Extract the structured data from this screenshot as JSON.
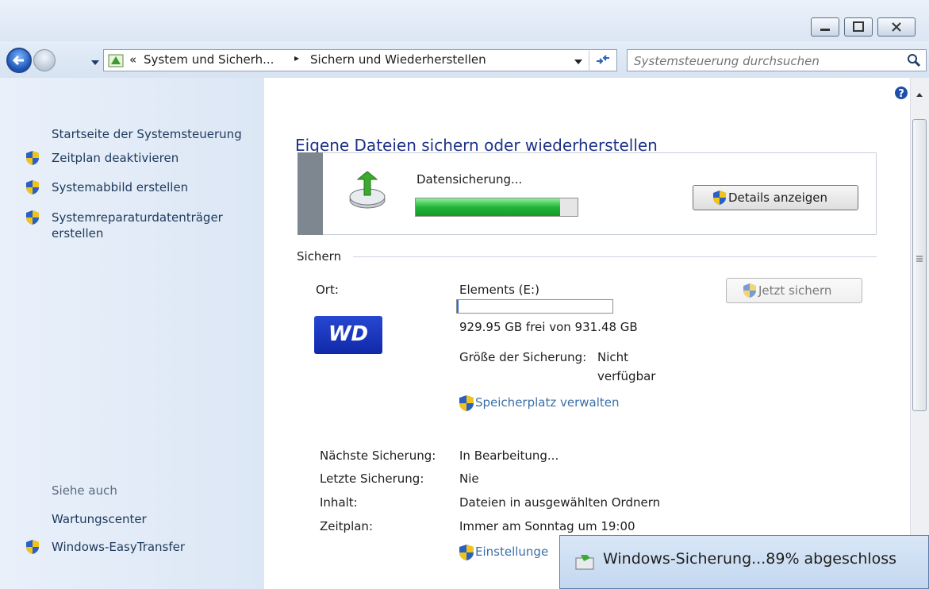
{
  "address_bar": {
    "crumb_overflow": "«",
    "crumb_1": "System und Sicherh...",
    "crumb_sep": "▸",
    "crumb_2": "Sichern und Wiederherstellen"
  },
  "search": {
    "placeholder": "Systemsteuerung durchsuchen"
  },
  "sidebar": {
    "home": "Startseite der Systemsteuerung",
    "tasks": [
      "Zeitplan deaktivieren",
      "Systemabbild erstellen",
      "Systemreparaturdatenträger",
      "erstellen"
    ],
    "see_also_header": "Siehe auch",
    "see_also": [
      "Wartungscenter",
      "Windows-EasyTransfer"
    ]
  },
  "main": {
    "title": "Eigene Dateien sichern oder wiederherstellen",
    "status_text": "Datensicherung...",
    "progress": 0.89,
    "details_button": "Details anzeigen",
    "section_label": "Sichern",
    "location_label": "Ort:",
    "location_value": "Elements (E:)",
    "drive_used_fraction": 0.002,
    "free_space": "929.95 GB frei von 931.48 GB",
    "backup_size_label": "Größe der Sicherung:",
    "backup_size_value_1": "Nicht",
    "backup_size_value_2": "verfügbar",
    "manage_space_link": "Speicherplatz verwalten",
    "backup_now_button": "Jetzt sichern",
    "drive_logo_text": "WD",
    "next_backup_label": "Nächste Sicherung:",
    "next_backup_value": "In Bearbeitung...",
    "last_backup_label": "Letzte Sicherung:",
    "last_backup_value": "Nie",
    "content_label": "Inhalt:",
    "content_value": "Dateien in ausgewählten Ordnern",
    "schedule_label": "Zeitplan:",
    "schedule_value": "Immer am Sonntag um 19:00",
    "settings_link": "Einstellunge"
  },
  "popup": {
    "title": "Windows-Sicherung...89% abgeschloss"
  },
  "colors": {
    "link": "#1e395b",
    "title_blue": "#1e3287",
    "progress_green": "#22b43a",
    "shield_blue": "#2a5fc4",
    "shield_yellow": "#f0c419"
  }
}
